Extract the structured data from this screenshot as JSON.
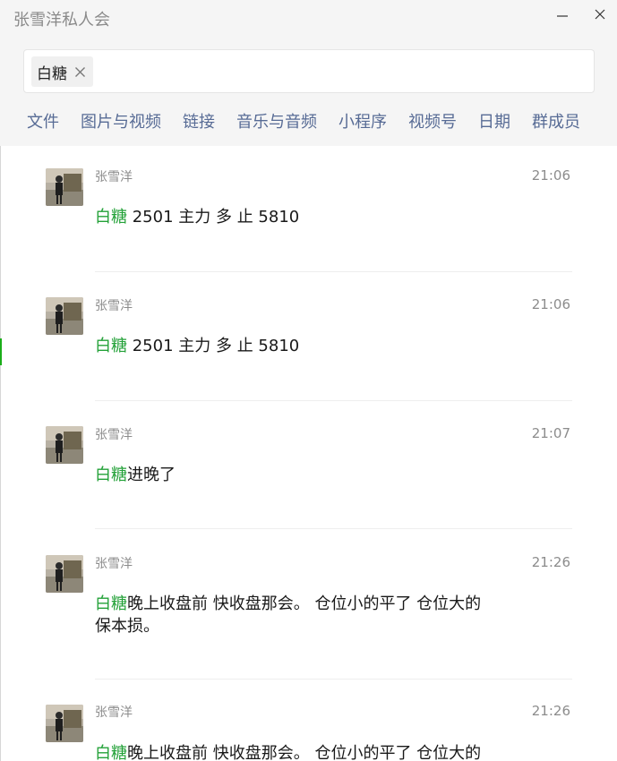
{
  "window": {
    "title": "张雪洋私人会"
  },
  "search": {
    "chip_label": "白糖"
  },
  "filters": [
    "文件",
    "图片与视频",
    "链接",
    "音乐与音频",
    "小程序",
    "视频号",
    "日期",
    "群成员"
  ],
  "colors": {
    "highlight": "#23a138",
    "link": "#576b95",
    "header_bg": "#f5f5f5"
  },
  "icons": {
    "minimize": "minimize-icon",
    "close": "close-icon",
    "chip_remove": "close-icon"
  },
  "messages": [
    {
      "sender": "张雪洋",
      "time": "21:06",
      "keyword": "白糖",
      "text": " 2501  主力 多 止 5810"
    },
    {
      "sender": "张雪洋",
      "time": "21:06",
      "keyword": "白糖",
      "text": " 2501  主力 多 止 5810"
    },
    {
      "sender": "张雪洋",
      "time": "21:07",
      "keyword": "白糖",
      "text": "进晚了"
    },
    {
      "sender": "张雪洋",
      "time": "21:26",
      "keyword": "白糖",
      "text": "晚上收盘前 快收盘那会。  仓位小的平了  仓位大的保本损。"
    },
    {
      "sender": "张雪洋",
      "time": "21:26",
      "keyword": "白糖",
      "text": "晚上收盘前 快收盘那会。  仓位小的平了  仓位大的"
    }
  ]
}
